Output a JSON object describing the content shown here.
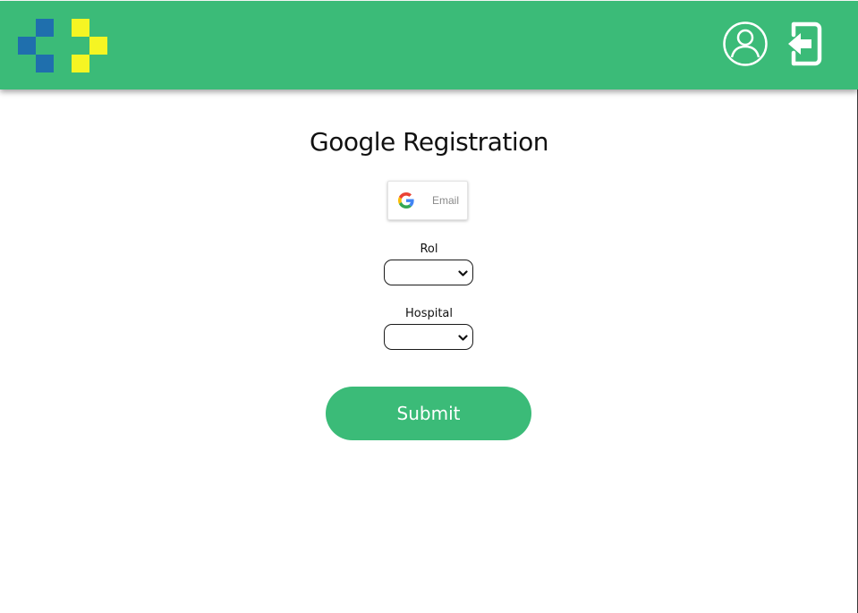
{
  "header": {
    "background_color": "#3bbb78",
    "logo": {
      "name": "logo-icon",
      "colors": {
        "blue": "#1f6fad",
        "yellow": "#f5f523"
      }
    },
    "actions": [
      {
        "name": "user-profile-icon"
      },
      {
        "name": "logout-icon"
      }
    ]
  },
  "main": {
    "title": "Google Registration",
    "google_button": {
      "icon": "google-icon",
      "label": "Email"
    },
    "fields": {
      "rol": {
        "label": "Rol",
        "selected_value": ""
      },
      "hospital": {
        "label": "Hospital",
        "selected_value": ""
      }
    },
    "submit_label": "Submit",
    "accent_color": "#3bbb78"
  }
}
